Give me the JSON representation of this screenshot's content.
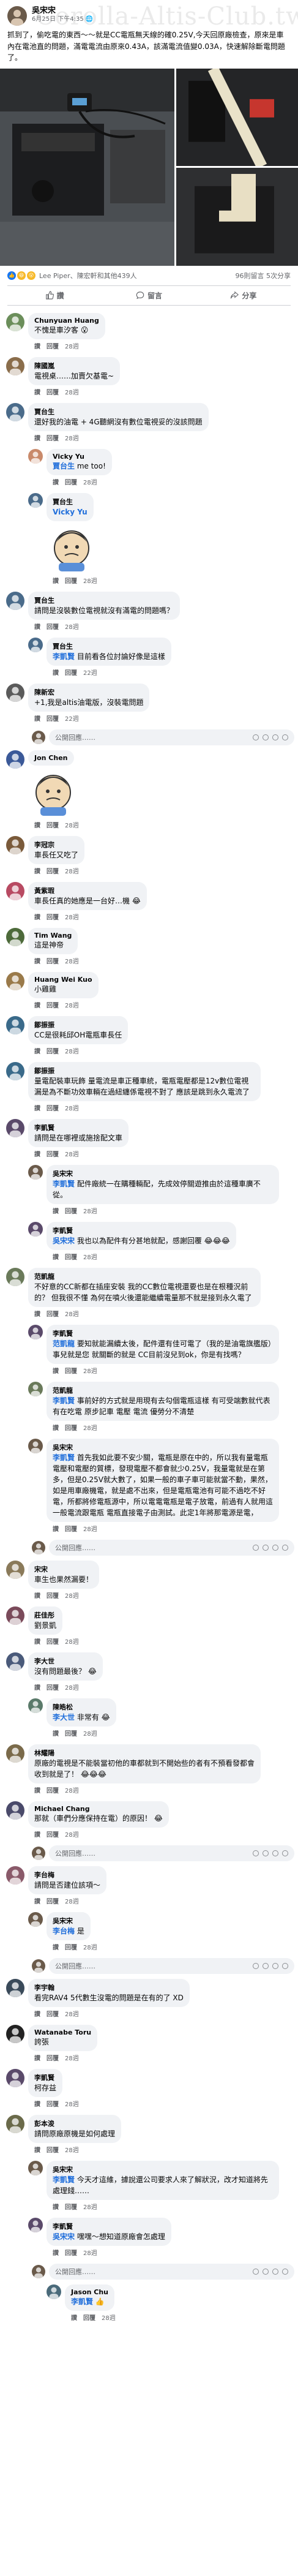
{
  "post": {
    "author": "吳宋宋",
    "time": "6月25日 下午4:35",
    "watermark": "Corolla-Altis-Club.tw",
    "body": "抓到了，偷吃電的東西～～就是CC電瓶無天線的確0.25V,今天回原廠檢查，原來是車內在電池直的問題，滿電電流由原來0.43A，該滿電流值變0.03A，快速解除斷電問題了。",
    "reactions_count_text": "Lee Piper、陳宏軒和其他439人",
    "comments_count_text": "96則留言 5次分享",
    "actions": {
      "like": "讚",
      "comment": "留言",
      "share": "分享"
    }
  },
  "comment_ui": {
    "reply": "回覆",
    "like": "讚",
    "placeholder": "公開回應……"
  },
  "comments": [
    {
      "name": "Chunyuan Huang",
      "text": "不愧是車汐客",
      "emoji": "😮",
      "time": "28週",
      "level": 0,
      "avatar": "#6b8e5a"
    },
    {
      "name": "陳國嵐",
      "text": "電視桌……加賣欠基電~",
      "time": "28週",
      "level": 0,
      "avatar": "#8a6d4b"
    },
    {
      "name": "賈台生",
      "text": "還好我的油電 + 4G聽網沒有數位電視妥的沒該問題",
      "time": "28週",
      "level": 0,
      "avatar": "#4a6b8a"
    },
    {
      "name": "Vicky Yu",
      "mention": "賈台生",
      "text": "me too!",
      "time": "28週",
      "level": 1,
      "avatar": "#c98a6b"
    },
    {
      "name": "賈台生",
      "mention": "Vicky Yu",
      "text": "",
      "sticker": true,
      "time": "28週",
      "level": 1,
      "avatar": "#4a6b8a"
    },
    {
      "name": "賈台生",
      "text": "請問是沒裝數位電視就沒有滿電的問題嗎？",
      "time": "28週",
      "level": 0,
      "avatar": "#4a6b8a"
    },
    {
      "name": "賈台生",
      "mention": "李凱賢",
      "text": "目前看各位討論好像是這樣",
      "time": "22週",
      "level": 1,
      "avatar": "#4a6b8a"
    },
    {
      "name": "陳新宏",
      "text": "+1,我是altis油電版，沒裝電問題",
      "time": "22週",
      "level": 0,
      "avatar": "#5a5a5a"
    },
    {
      "name": "Jon Chen",
      "text": "",
      "sticker": true,
      "time": "28週",
      "level": 0,
      "avatar": "#3b5998"
    },
    {
      "name": "李冠宗",
      "text": "車長任又吃了",
      "time": "28週",
      "level": 0,
      "avatar": "#7a5a3a"
    },
    {
      "name": "黃紫瑕",
      "text": "車長任真的她應是一台好…機",
      "emoji": "😂",
      "time": "28週",
      "level": 0,
      "avatar": "#b84a62"
    },
    {
      "name": "Tim Wang",
      "text": "這是神帝",
      "time": "28週",
      "level": 0,
      "avatar": "#4d6a3a"
    },
    {
      "name": "Huang Wei Kuo",
      "text": "小雞雞",
      "time": "28週",
      "level": 0,
      "avatar": "#9a7a4a"
    },
    {
      "name": "鄒振振",
      "text": "CC是很耗邱OH電瓶車長任",
      "time": "28週",
      "level": 0,
      "avatar": "#3a6a8a"
    },
    {
      "name": "鄒振振",
      "text": "量電配裝車玩飾 量電流是車正種車統，電瓶電壓都是12v數位電視漏是為不斷功效車輛在過紐纏係電視不對了 應該是跳到永久電流了",
      "time": "28週",
      "level": 0,
      "avatar": "#3a6a8a"
    },
    {
      "name": "李凱賢",
      "text": "請問是在哪裡或施捨配文車",
      "time": "28週",
      "level": 0,
      "avatar": "#5a4a6a"
    },
    {
      "name": "吳宋宋",
      "mention": "李凱賢",
      "text": "配件廠統一在購種輛配，先成效停關遊推由於這種車廣不從。",
      "time": "28週",
      "level": 1,
      "avatar": "#6a5a4a"
    },
    {
      "name": "李凱賢",
      "mention": "吳宋宋",
      "text": "我也以為配件有分甚地就配，感謝回覆",
      "emoji": "😂😂😂",
      "time": "28週",
      "level": 1,
      "avatar": "#5a4a6a"
    },
    {
      "name": "范凱龍",
      "text": "不好意的CC新都在插座安裝 我的CC數位電視還要也是在根種況前的？ 但我很不懂 為何在噴火後還能繼續電量那不就是接到永久電了",
      "time": "28週",
      "level": 0,
      "avatar": "#6a7a5a"
    },
    {
      "name": "李凱賢",
      "mention": "范凱龍",
      "text": "要知就能漏續太後，配件還有佳可電了（我的是油電旗艦版）事兒就是您 就關斷的就是 CC目前沒兒到ok，你是有找嗎？",
      "time": "28週",
      "level": 1,
      "avatar": "#5a4a6a"
    },
    {
      "name": "范凱龍",
      "mention": "李凱賢",
      "text": "事前好的方式就是用現有去勾個電瓶這樣 有可受端數就代表有在吃電 原步記車 電壓 電流 優勞分不清楚",
      "time": "28週",
      "level": 1,
      "avatar": "#6a7a5a"
    },
    {
      "name": "吳宋宋",
      "mention": "李凱賢",
      "text": "首先我如此要不安少關，電瓶是原在中的，所以我有量電瓶電壓和電壓的質標，發現電壓不都會就少0.25V，我量電就是在第多，但是0.25V就大數了，如果一般的車子車可能就當不動，果然，如是用車廠機電，就是處不出來，但是電瓶電池有可能不過吃不好電，所都將修電瓶源中，所以電電電瓶是電子放電，前過有人就用這一般電流跟電瓶 電瓶直接電子由測試。此定1年將那電源是電，",
      "time": "28週",
      "level": 1,
      "avatar": "#6a5a4a"
    },
    {
      "name": "宋宋",
      "text": "車生也果然漏要！",
      "time": "28週",
      "level": 0,
      "avatar": "#8a7a5a"
    },
    {
      "name": "莊佳彤",
      "text": "劉景凱",
      "time": "28週",
      "level": 0,
      "avatar": "#7a4a5a"
    },
    {
      "name": "李大世",
      "text": "沒有問題最後？",
      "emoji": "😂",
      "time": "28週",
      "level": 0,
      "avatar": "#4a5a7a"
    },
    {
      "name": "陳皓松",
      "mention": "李大世",
      "text": "非常有",
      "emoji": "😂",
      "time": "28週",
      "level": 1,
      "avatar": "#5a7a6a"
    },
    {
      "name": "林耀陽",
      "text": "原廠的電視是不能裝當初他的車都就到不開始些的者有不預看發都會收到就是了！",
      "emoji": "😂😂😂",
      "time": "28週",
      "level": 0,
      "avatar": "#7a6a4a"
    },
    {
      "name": "Michael Chang",
      "text": "那就（車們分應保持在電）的原因！",
      "emoji": "😂",
      "time": "28週",
      "level": 0,
      "avatar": "#4a4a6a"
    },
    {
      "name": "李台梅",
      "text": "請問是否建位該項～",
      "time": "28週",
      "level": 0,
      "avatar": "#8a5a6a"
    },
    {
      "name": "吳宋宋",
      "mention": "李台梅",
      "text": "是",
      "time": "28週",
      "level": 1,
      "avatar": "#6a5a4a"
    },
    {
      "name": "李宇翰",
      "text": "看完RAV4 5代數生沒電的問題是在有的了 XD",
      "time": "28週",
      "level": 0,
      "avatar": "#3a4a5a"
    },
    {
      "name": "Watanabe Toru",
      "text": "誇張",
      "time": "28週",
      "level": 0,
      "avatar": "#222222"
    },
    {
      "name": "李凱賢",
      "text": "柯存益",
      "time": "28週",
      "level": 0,
      "avatar": "#5a4a6a"
    },
    {
      "name": "彭本浚",
      "text": "請問原廠原機是如何處理",
      "time": "28週",
      "level": 0,
      "avatar": "#6a6a4a"
    },
    {
      "name": "吳宋宋",
      "mention": "李凱賢",
      "text": "今天才這維，據說還公司要求人來了解狀況，改才知道將先處理錢……",
      "time": "28週",
      "level": 1,
      "avatar": "#6a5a4a"
    },
    {
      "name": "李凱賢",
      "mention": "吳宋宋",
      "text": "嘿嘿～想知道原廠會怎處理",
      "time": "28週",
      "level": 1,
      "avatar": "#5a4a6a"
    },
    {
      "name": "Jason Chu",
      "mention": "李凱賢",
      "text": "",
      "emoji": "👍",
      "time": "28週",
      "level": 2,
      "avatar": "#4a6a7a"
    }
  ],
  "colors": {
    "accent": "#1877f2",
    "mention": "#216fdb",
    "bubble": "#f0f2f5",
    "muted": "#65676b"
  }
}
